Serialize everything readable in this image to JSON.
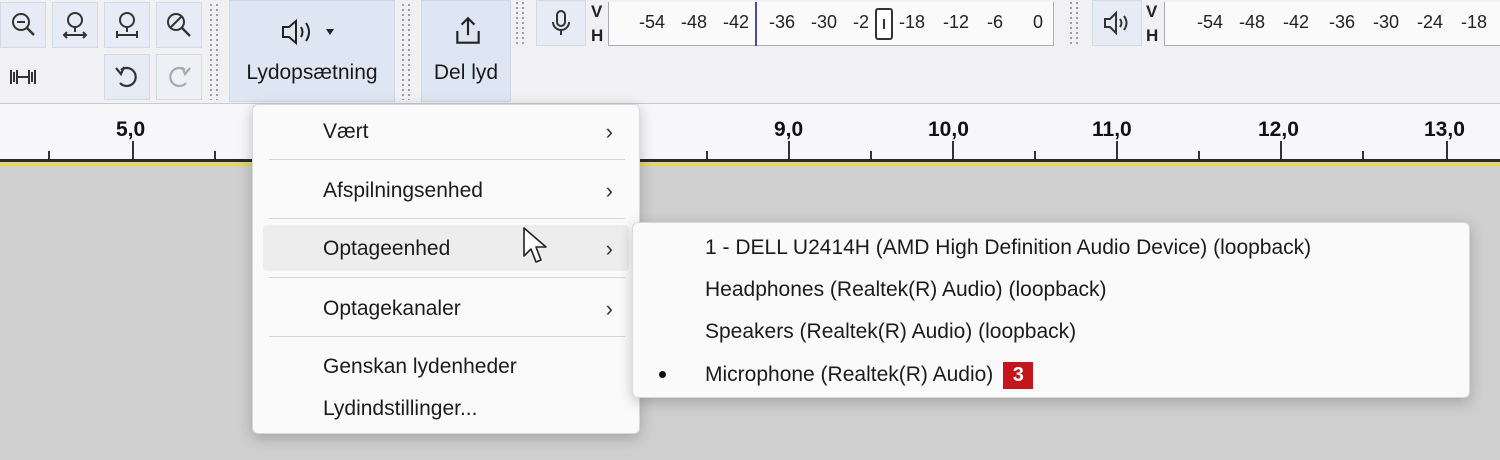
{
  "toolbar": {
    "audio_setup_label": "Lydopsætning",
    "share_audio_label": "Del lyd",
    "icons": [
      "zoom-in-icon",
      "zoom-selection-icon",
      "zoom-fit-icon",
      "zoom-toggle-icon",
      "trim-icon",
      "undo-icon",
      "redo-icon",
      "speaker-icon",
      "share-icon",
      "microphone-icon"
    ]
  },
  "recording_meter": {
    "v_label": "V",
    "h_label": "H",
    "ticks": [
      "-54",
      "-48",
      "-42",
      "-36",
      "-30",
      "-2",
      "-18",
      "-12",
      "-6",
      "0"
    ]
  },
  "playback_meter": {
    "v_label": "V",
    "h_label": "H",
    "ticks": [
      "-54",
      "-48",
      "-42",
      "-36",
      "-30",
      "-24",
      "-18"
    ]
  },
  "ruler": {
    "labels": [
      "5,0",
      "9,0",
      "10,0",
      "11,0",
      "12,0",
      "13,0"
    ]
  },
  "main_menu": {
    "items": [
      {
        "label": "Vært",
        "submenu": true
      },
      {
        "label": "Afspilningsenhed",
        "submenu": true
      },
      {
        "label": "Optageenhed",
        "submenu": true
      },
      {
        "label": "Optagekanaler",
        "submenu": true
      },
      {
        "label": "Genskan lydenheder",
        "submenu": false
      },
      {
        "label": "Lydindstillinger...",
        "submenu": false
      }
    ],
    "chevron": "›"
  },
  "recording_device_menu": {
    "items": [
      {
        "label": "1 - DELL U2414H (AMD High Definition Audio Device) (loopback)",
        "selected": false
      },
      {
        "label": "Headphones (Realtek(R) Audio) (loopback)",
        "selected": false
      },
      {
        "label": "Speakers (Realtek(R) Audio) (loopback)",
        "selected": false
      },
      {
        "label": "Microphone (Realtek(R) Audio)",
        "selected": true
      }
    ],
    "callout_badge": "3"
  },
  "colors": {
    "toolbar_bg": "#f1f1f4",
    "button_bg": "#e6ebf5",
    "badge_red": "#c4161c",
    "ruler_accent": "#e8d84a"
  }
}
